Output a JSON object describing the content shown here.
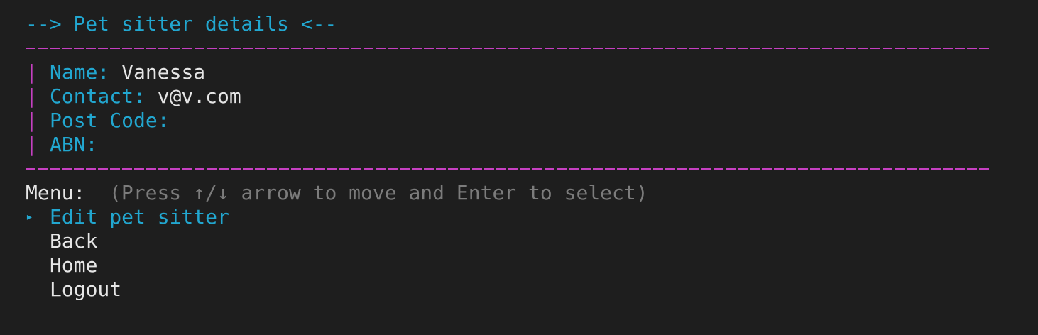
{
  "header": {
    "title": "--> Pet sitter details <--"
  },
  "details": {
    "fields": [
      {
        "label": "Name:",
        "value": "Vanessa"
      },
      {
        "label": "Contact:",
        "value": "v@v.com"
      },
      {
        "label": "Post Code:",
        "value": ""
      },
      {
        "label": "ABN:",
        "value": ""
      }
    ],
    "bar_char": "|"
  },
  "menu": {
    "label": "Menu:",
    "hint": "(Press ↑/↓ arrow to move and Enter to select)",
    "pointer": "▸",
    "items": [
      {
        "label": "Edit pet sitter",
        "selected": true
      },
      {
        "label": "Back",
        "selected": false
      },
      {
        "label": "Home",
        "selected": false
      },
      {
        "label": "Logout",
        "selected": false
      }
    ]
  },
  "colors": {
    "background": "#1e1e1e",
    "accent_cyan": "#22a7d0",
    "accent_magenta": "#c640c2",
    "hint_gray": "#7c7c7c",
    "text": "#e6e6e6"
  }
}
